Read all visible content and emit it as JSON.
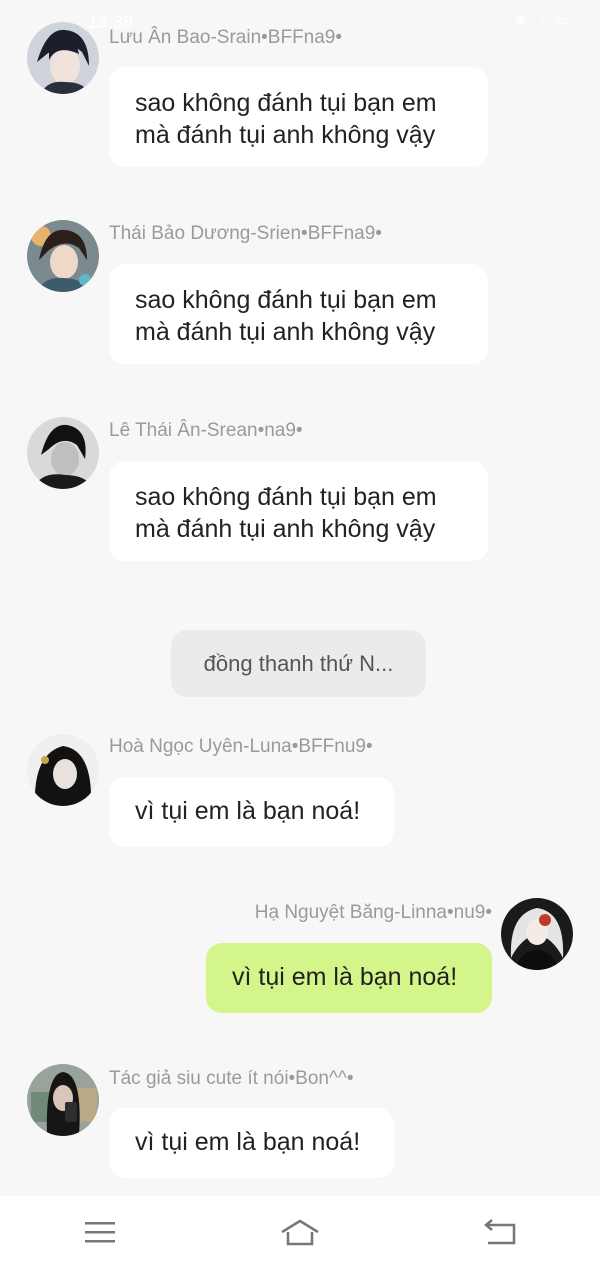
{
  "status_bar": {
    "time": "13:38"
  },
  "messages": [
    {
      "sender": "Lưu Ân Bao-Srain•BFFna9•",
      "lines": [
        "sao không đánh tụi bạn em",
        "mà đánh tụi anh không vậy"
      ],
      "avatar": "boy-avatar-1"
    },
    {
      "sender": "Thái Bảo Dương-Srien•BFFna9•",
      "lines": [
        "sao không đánh tụi bạn em",
        "mà đánh tụi anh không vậy"
      ],
      "avatar": "boy-avatar-2"
    },
    {
      "sender": "Lê Thái Ân-Srean•na9•",
      "lines": [
        "sao không đánh tụi bạn em",
        "mà đánh tụi anh không vậy"
      ],
      "avatar": "boy-avatar-3"
    },
    {
      "sender": "Hoà Ngọc Uyên-Luna•BFFnu9•",
      "text": "vì tụi em là bạn noá!",
      "avatar": "girl-avatar-1"
    },
    {
      "sender": "Hạ Nguyệt Băng-Linna•nu9•",
      "text": "vì tụi em là bạn noá!",
      "avatar": "girl-avatar-2",
      "mine": true
    },
    {
      "sender": "Tác giả siu cute ít nói•Bon^^•",
      "text": "vì tụi em là bạn noá!",
      "avatar": "author-avatar"
    }
  ],
  "system_message": "đồng thanh thứ N...",
  "nav": {
    "menu": "menu-icon",
    "home": "home-icon",
    "back": "back-icon"
  },
  "colors": {
    "background": "#f7f7f7",
    "bubble": "#ffffff",
    "my_bubble": "#d4f58a",
    "sender_text": "#9a9a9a"
  }
}
